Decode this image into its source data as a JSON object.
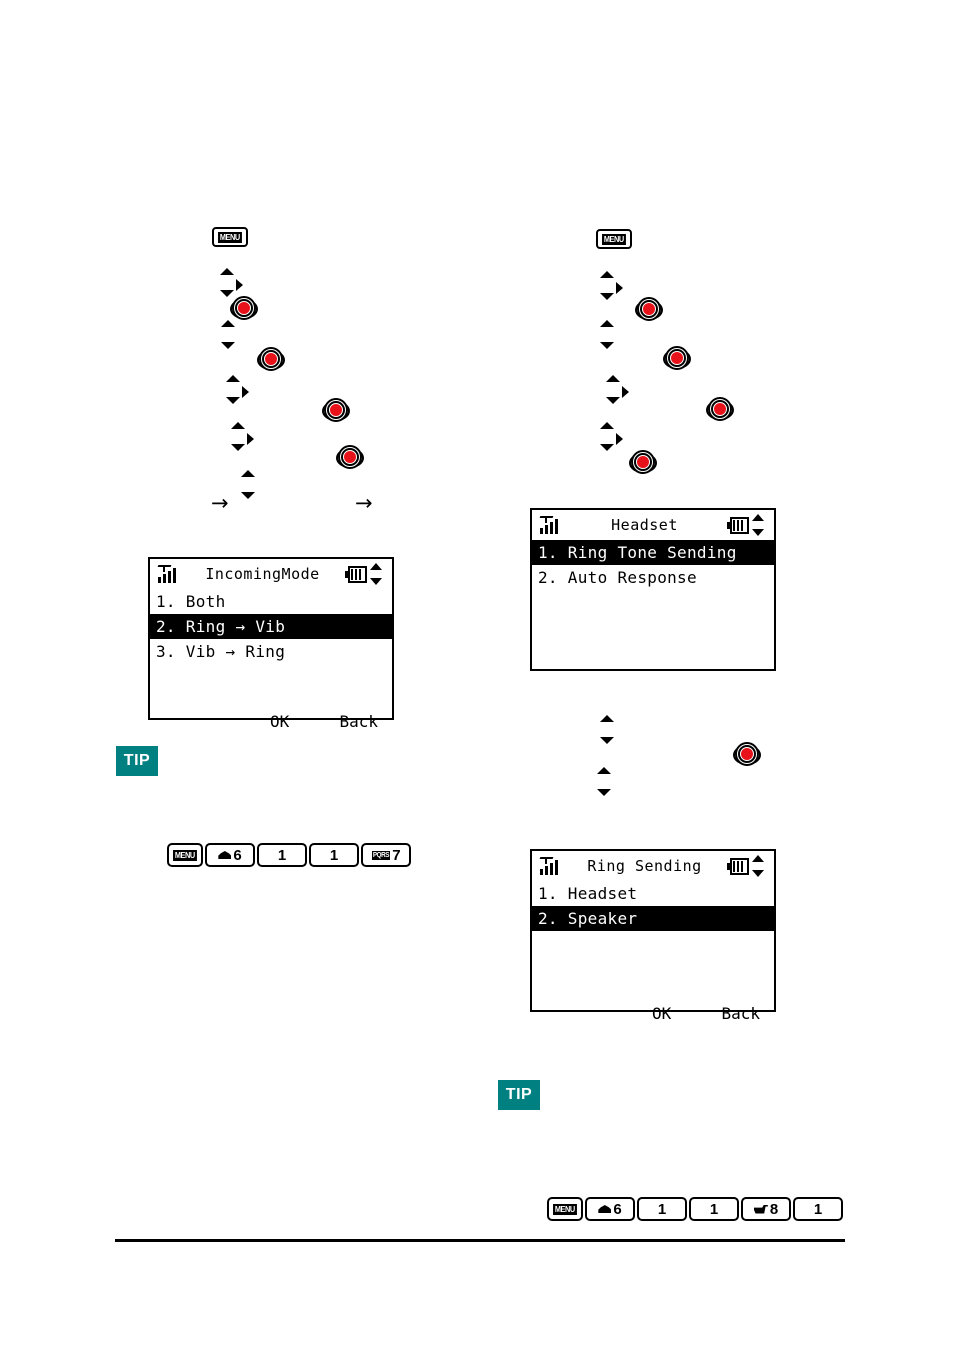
{
  "colors": {
    "tip_badge": "#008080",
    "enter_key_dot": "#e8131a",
    "ink": "#000000",
    "paper": "#ffffff"
  },
  "left_column": {
    "menu_key": {
      "label": "MENU"
    },
    "nav_steps": [
      {
        "kind": "nav-updown-right"
      },
      {
        "kind": "enter"
      },
      {
        "kind": "nav-updown"
      },
      {
        "kind": "enter"
      },
      {
        "kind": "nav-updown-right"
      },
      {
        "kind": "enter"
      },
      {
        "kind": "nav-updown-right"
      },
      {
        "kind": "enter"
      },
      {
        "kind": "nav-updown"
      }
    ],
    "flow_arrows": [
      "→",
      "→"
    ],
    "screen": {
      "title": "IncomingMode",
      "signal_icon": "signal-bars-icon",
      "battery_icon": "battery-icon",
      "scroll_icon": "up-down-arrows-icon",
      "items": [
        {
          "label": "1. Both",
          "selected": false
        },
        {
          "label": "2. Ring → Vib",
          "selected": true
        },
        {
          "label": "3. Vib → Ring",
          "selected": false
        }
      ],
      "softkeys": {
        "ok": "OK",
        "back": "Back"
      }
    },
    "tip_badge": "TIP",
    "key_sequence": [
      {
        "type": "menu",
        "label": "MENU"
      },
      {
        "type": "glyph-number",
        "glyph": "mail-icon",
        "label": "6"
      },
      {
        "type": "number",
        "label": "1"
      },
      {
        "type": "number",
        "label": "1"
      },
      {
        "type": "glyph-number",
        "glyph": "pqrs-icon",
        "glyph_text": "PQRS",
        "label": "7"
      }
    ]
  },
  "right_column": {
    "menu_key": {
      "label": "MENU"
    },
    "nav_steps": [
      {
        "kind": "nav-updown-right"
      },
      {
        "kind": "enter"
      },
      {
        "kind": "nav-updown"
      },
      {
        "kind": "enter"
      },
      {
        "kind": "nav-updown-right"
      },
      {
        "kind": "enter"
      },
      {
        "kind": "nav-updown-right"
      },
      {
        "kind": "enter"
      }
    ],
    "screen_headset": {
      "title": "Headset",
      "signal_icon": "signal-bars-icon",
      "battery_icon": "battery-icon",
      "scroll_icon": "up-down-arrows-icon",
      "items": [
        {
          "label": "1. Ring Tone Sending",
          "selected": true
        },
        {
          "label": "2. Auto Response",
          "selected": false
        }
      ]
    },
    "mid_nav_steps": [
      {
        "kind": "nav-updown"
      },
      {
        "kind": "nav-updown"
      },
      {
        "kind": "enter"
      }
    ],
    "screen_ring_sending": {
      "title": "Ring Sending",
      "signal_icon": "signal-bars-icon",
      "battery_icon": "battery-icon",
      "scroll_icon": "up-down-arrows-icon",
      "items": [
        {
          "label": "1. Headset",
          "selected": false
        },
        {
          "label": "2. Speaker",
          "selected": true
        }
      ],
      "softkeys": {
        "ok": "OK",
        "back": "Back"
      }
    },
    "tip_badge": "TIP",
    "key_sequence": [
      {
        "type": "menu",
        "label": "MENU"
      },
      {
        "type": "glyph-number",
        "glyph": "mail-icon",
        "label": "6"
      },
      {
        "type": "number",
        "label": "1"
      },
      {
        "type": "number",
        "label": "1"
      },
      {
        "type": "glyph-number",
        "glyph": "cart-icon",
        "label": "8"
      },
      {
        "type": "number",
        "label": "1"
      }
    ]
  }
}
